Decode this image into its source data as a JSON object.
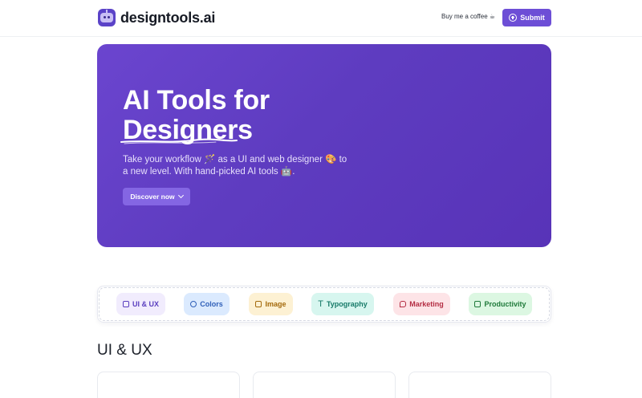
{
  "header": {
    "brand": "designtools.ai",
    "coffee_label": "Buy me a coffee ☕",
    "submit_label": "Submit"
  },
  "hero": {
    "title_line1": "AI Tools for",
    "title_line2": "Designers",
    "subtitle": "Take your workflow 🪄 as a UI and web designer 🎨 to a new level. With hand-picked AI tools 🤖.",
    "cta_label": "Discover now"
  },
  "categories": [
    {
      "label": "UI & UX",
      "icon": "layers-icon"
    },
    {
      "label": "Colors",
      "icon": "palette-icon"
    },
    {
      "label": "Image",
      "icon": "image-icon"
    },
    {
      "label": "Typography",
      "icon": "type-icon"
    },
    {
      "label": "Marketing",
      "icon": "chat-icon"
    },
    {
      "label": "Productivity",
      "icon": "checklist-icon"
    }
  ],
  "section": {
    "title": "UI & UX"
  },
  "colors": {
    "primary": "#6d4ed6",
    "hero_bg": "#5e3cc0"
  }
}
